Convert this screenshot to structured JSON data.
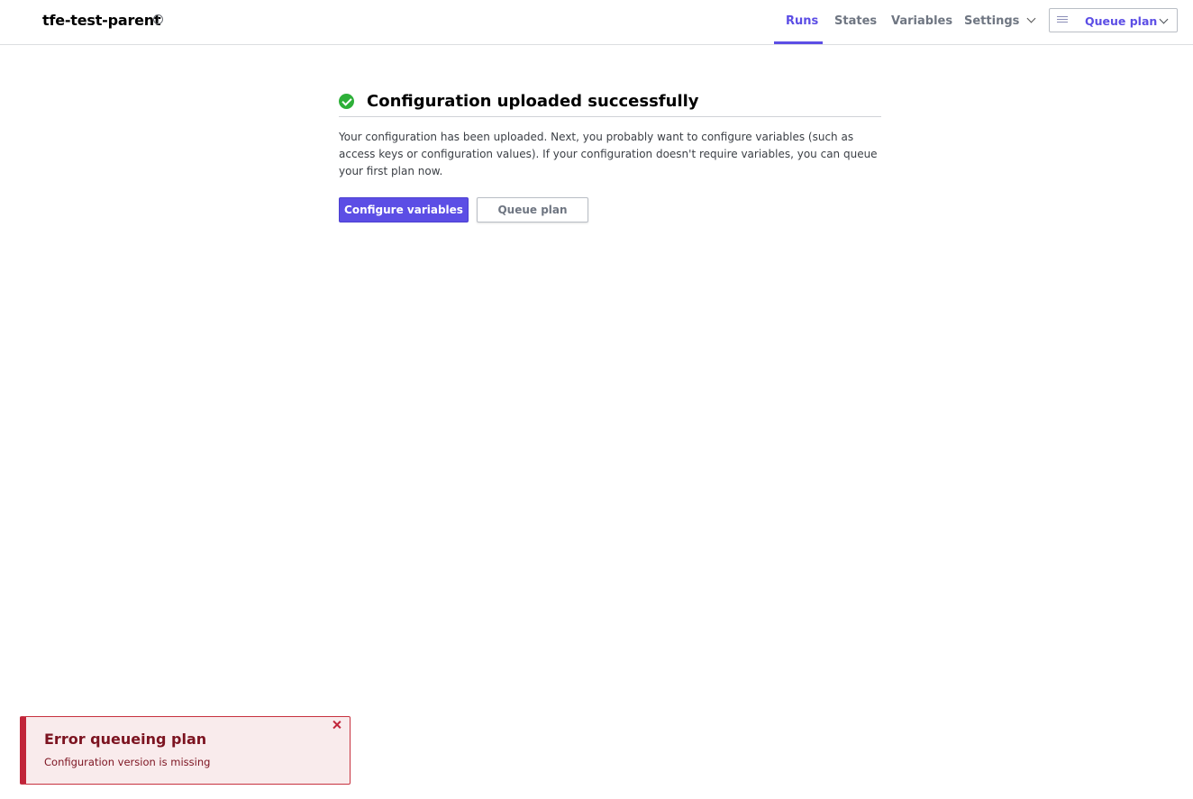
{
  "workspace": {
    "name": "tfe-test-parent",
    "info_icon": "info-icon"
  },
  "nav": {
    "runs": "Runs",
    "states": "States",
    "variables": "Variables",
    "settings": "Settings"
  },
  "queue_dropdown": {
    "label": "Queue plan",
    "icon": "list-icon"
  },
  "main": {
    "title": "Configuration uploaded successfully",
    "description": "Your configuration has been uploaded. Next, you probably want to configure variables (such as access keys or configuration values). If your configuration doesn't require variables, you can queue your first plan now.",
    "configure_button": "Configure variables",
    "queue_button": "Queue plan"
  },
  "toast": {
    "title": "Error queueing plan",
    "message": "Configuration version is missing"
  },
  "colors": {
    "accent": "#5c4ee5",
    "success": "#2eb039",
    "error": "#c1253a"
  }
}
